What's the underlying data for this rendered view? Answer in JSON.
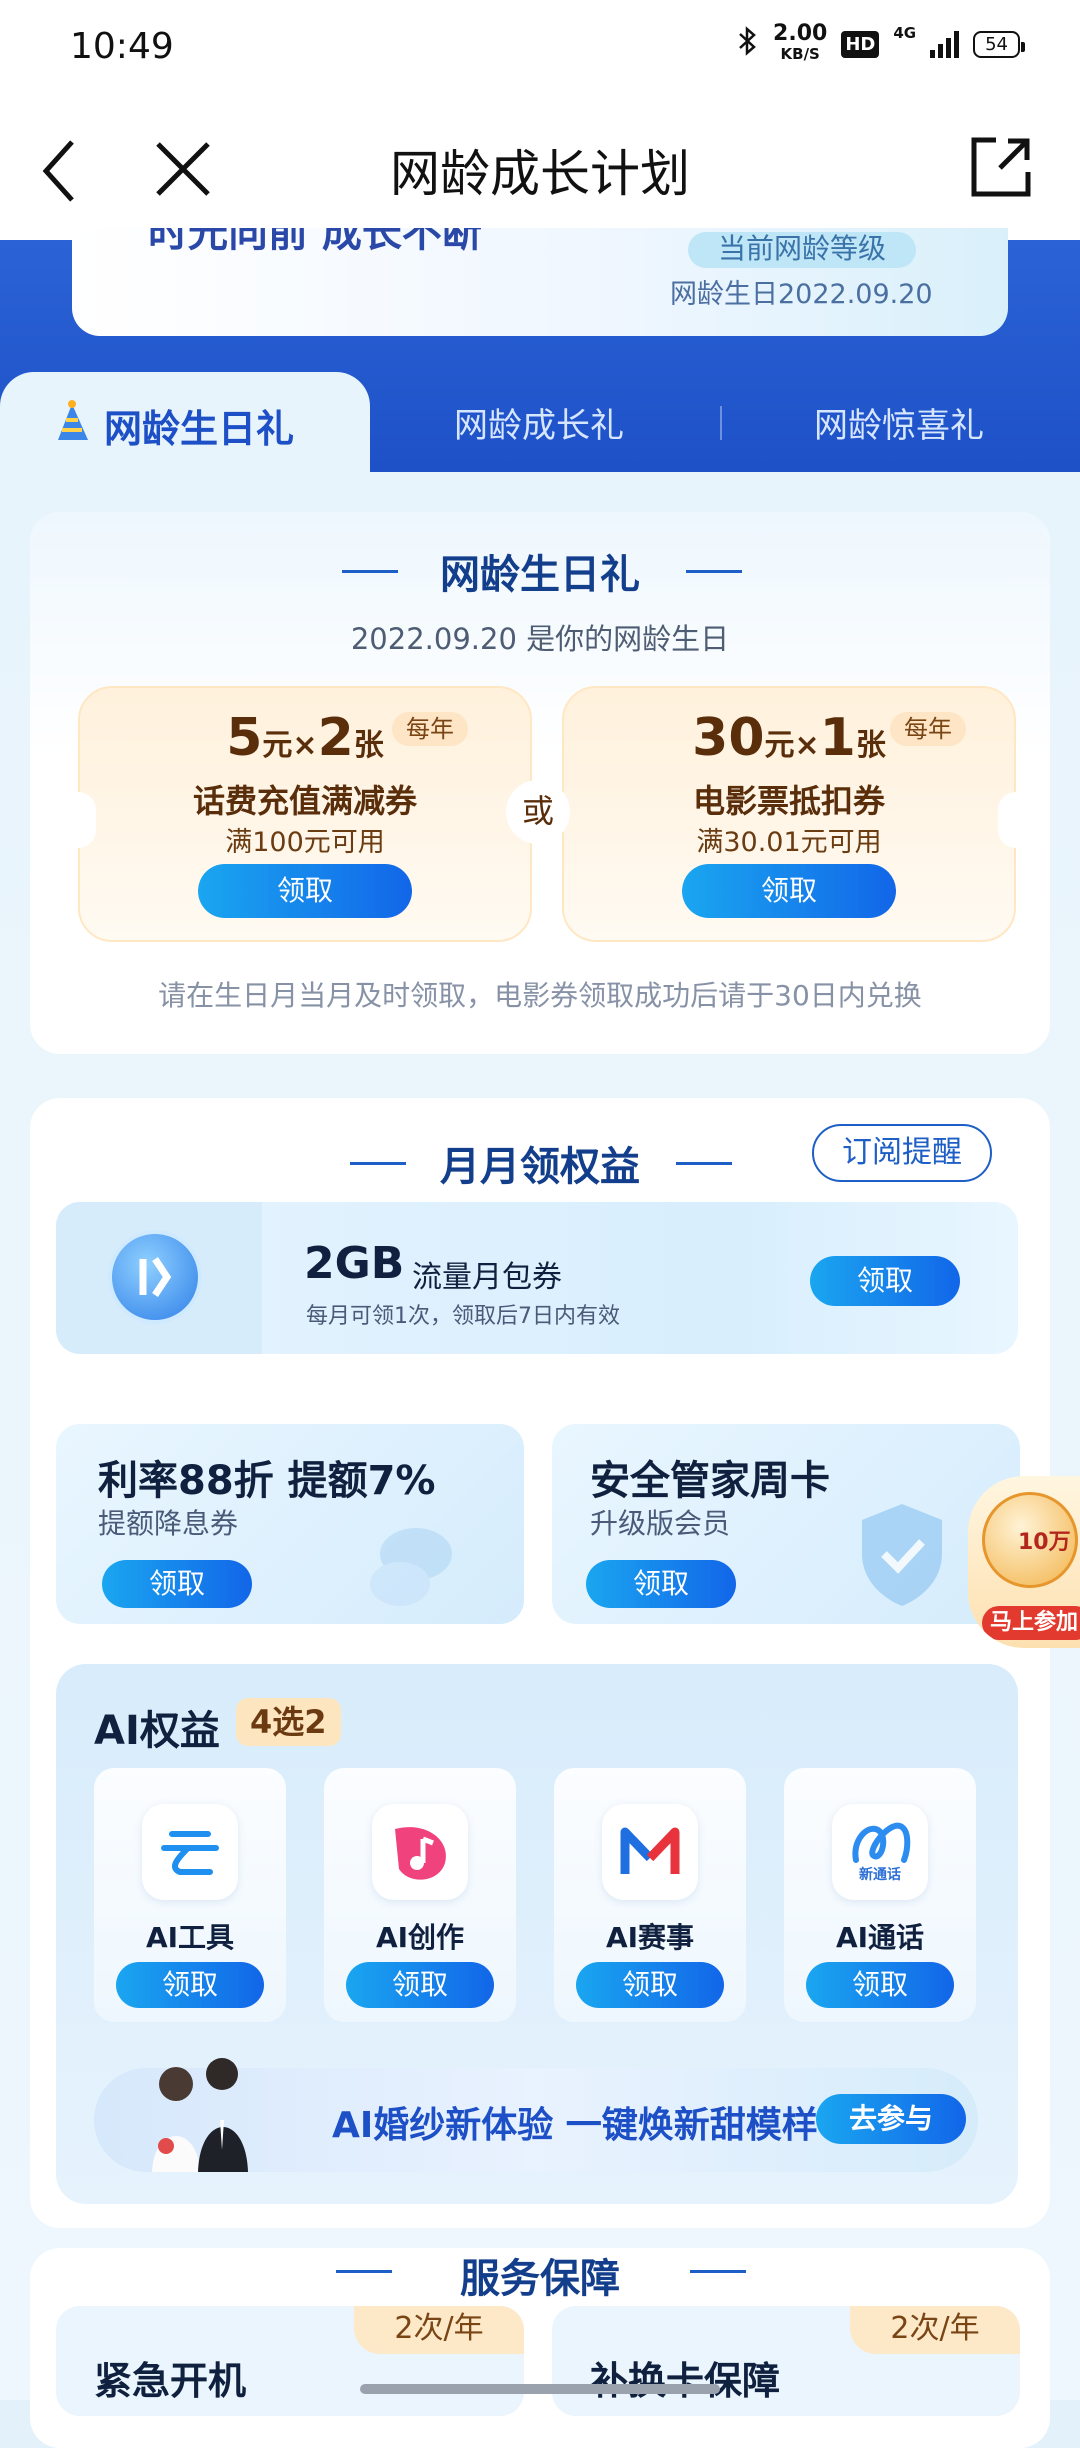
{
  "status_bar": {
    "time": "10:49",
    "net_speed": "2.00",
    "net_unit": "KB/S",
    "hd": "HD",
    "signal": "4G",
    "battery": "54"
  },
  "nav": {
    "title": "网龄成长计划"
  },
  "level_card": {
    "slogan": "时光向前 成长不断",
    "level_label": "当前网龄等级",
    "birthday": "网龄生日2022.09.20"
  },
  "tabs": [
    {
      "label": "网龄生日礼",
      "active": true
    },
    {
      "label": "网龄成长礼",
      "active": false
    },
    {
      "label": "网龄惊喜礼",
      "active": false
    }
  ],
  "birthday_gift": {
    "title": "网龄生日礼",
    "subtitle": "2022.09.20 是你的网龄生日",
    "or_label": "或",
    "coupons": [
      {
        "amount": "5",
        "unit": "元",
        "times": "×",
        "count": "2",
        "count_unit": "张",
        "period": "每年",
        "name": "话费充值满减券",
        "condition": "满100元可用",
        "button": "领取"
      },
      {
        "amount": "30",
        "unit": "元",
        "times": "×",
        "count": "1",
        "count_unit": "张",
        "period": "每年",
        "name": "电影票抵扣券",
        "condition": "满30.01元可用",
        "button": "领取"
      }
    ],
    "note": "请在生日月当月及时领取，电影券领取成功后请于30日内兑换"
  },
  "monthly": {
    "title": "月月领权益",
    "subscribe_button": "订阅提醒",
    "flow": {
      "amount": "2GB",
      "name": "流量月包券",
      "desc": "每月可领1次，领取后7日内有效",
      "button": "领取"
    },
    "benefits": [
      {
        "title": "利率88折 提额7%",
        "subtitle": "提额降息券",
        "button": "领取"
      },
      {
        "title": "安全管家周卡",
        "subtitle": "升级版会员",
        "button": "领取"
      }
    ]
  },
  "ai": {
    "title": "AI权益",
    "badge": "4选2",
    "items": [
      {
        "name": "AI工具",
        "icon": "cloud-app-icon",
        "button": "领取"
      },
      {
        "name": "AI创作",
        "icon": "music-app-icon",
        "button": "领取"
      },
      {
        "name": "AI赛事",
        "icon": "m-logo-app-icon",
        "button": "领取"
      },
      {
        "name": "AI通话",
        "icon": "call-app-icon",
        "icon_text": "新通话",
        "button": "领取"
      }
    ],
    "banner": {
      "text": "AI婚纱新体验 一键焕新甜模样",
      "button": "去参与"
    }
  },
  "service": {
    "title": "服务保障",
    "items": [
      {
        "title": "紧急开机",
        "tag": "2次/年"
      },
      {
        "title": "补换卡保障",
        "tag": "2次/年"
      }
    ]
  },
  "float_badge": {
    "text": "马上参加",
    "amount": "10万"
  },
  "colors": {
    "brand_blue": "#1d4fc6",
    "button_gradient_start": "#1aa6f0",
    "button_gradient_end": "#1266e8",
    "coupon_bg": "#fff1dc"
  }
}
